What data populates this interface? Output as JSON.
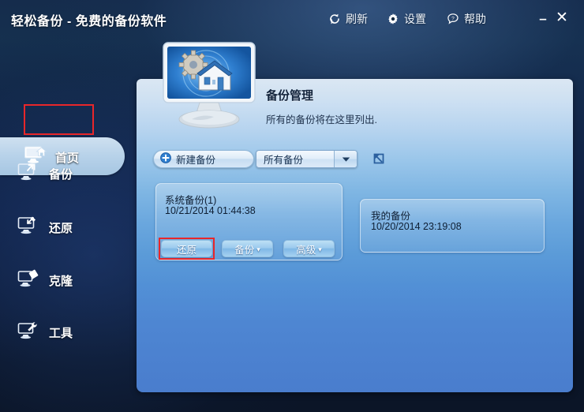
{
  "window": {
    "title": "轻松备份 - 免费的备份软件",
    "titlebar_actions": [
      {
        "label": "刷新",
        "icon": "refresh-icon"
      },
      {
        "label": "设置",
        "icon": "gear-icon"
      },
      {
        "label": "帮助",
        "icon": "help-icon"
      }
    ],
    "minimize": "–",
    "close": "✕"
  },
  "sidebar": {
    "items": [
      {
        "label": "首页",
        "icon": "monitor-home-icon",
        "selected": true
      },
      {
        "label": "备份",
        "icon": "monitor-backup-icon",
        "selected": false
      },
      {
        "label": "还原",
        "icon": "monitor-restore-icon",
        "selected": false
      },
      {
        "label": "克隆",
        "icon": "monitor-clone-icon",
        "selected": false
      },
      {
        "label": "工具",
        "icon": "monitor-tools-icon",
        "selected": false
      }
    ]
  },
  "main": {
    "hero_icon": "monitor-house-gear-icon",
    "title": "备份管理",
    "subtitle": "所有的备份将在这里列出.",
    "toolbar": {
      "new_backup_label": "新建备份",
      "new_backup_icon": "plus-circle-icon",
      "filter_value": "所有备份",
      "filter_arrow_icon": "chevron-down-icon",
      "refresh_icon": "refresh-list-icon"
    },
    "backups": [
      {
        "name": "系统备份(1)",
        "date": "10/21/2014 01:44:38",
        "actions": [
          {
            "label": "还原",
            "has_chevron": false,
            "highlighted": true
          },
          {
            "label": "备份",
            "has_chevron": true,
            "highlighted": false
          },
          {
            "label": "高级",
            "has_chevron": true,
            "highlighted": false
          }
        ]
      },
      {
        "name": "我的备份",
        "date": "10/20/2014 23:19:08",
        "actions": []
      }
    ]
  },
  "annotations": {
    "highlight_color": "#e8262a",
    "boxes": [
      "sidebar-item-home",
      "restore-button"
    ]
  },
  "colors": {
    "titlebar_bg": "#13283f",
    "panel_top": "#dbe7f3",
    "panel_bottom": "#4a7dcd",
    "sidebar_tab": "#b9d3ea",
    "accent_red": "#e8262a"
  }
}
